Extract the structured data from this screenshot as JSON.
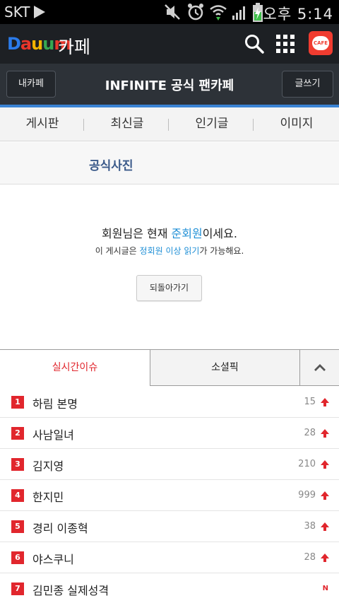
{
  "status_bar": {
    "carrier": "SKT",
    "time": "오후 5:14",
    "icons": [
      "play-icon",
      "mute-icon",
      "alarm-icon",
      "wifi-icon",
      "signal-icon",
      "battery-charging-icon"
    ]
  },
  "app_header": {
    "logo": "Daum",
    "app_name": "카페",
    "icons": [
      "search-icon",
      "apps-grid-icon",
      "cafe-app-icon"
    ],
    "cafe_icon_text": "CAFE"
  },
  "cafe_bar": {
    "my_cafe_label": "내카페",
    "cafe_title": "INFINITE 공식 팬카페",
    "write_label": "글쓰기"
  },
  "menu": {
    "items": [
      {
        "label": "게시판"
      },
      {
        "label": "최신글"
      },
      {
        "label": "인기글"
      },
      {
        "label": "이미지"
      }
    ]
  },
  "board": {
    "title": "공식사진"
  },
  "notice": {
    "main_prefix": "회원님은 현재 ",
    "main_highlight": "준회원",
    "main_suffix": "이세요.",
    "sub_prefix": "이 게시글은 ",
    "sub_highlight": "정회원 이상 읽기",
    "sub_suffix": "가 가능해요.",
    "back_label": "되돌아가기"
  },
  "issue_tabs": {
    "active": "실시간이슈",
    "realtime_label": "실시간이슈",
    "social_label": "소셜픽"
  },
  "issues": [
    {
      "rank": "1",
      "keyword": "하림 본명",
      "count": "15",
      "trend": "up"
    },
    {
      "rank": "2",
      "keyword": "사남일녀",
      "count": "28",
      "trend": "up"
    },
    {
      "rank": "3",
      "keyword": "김지영",
      "count": "210",
      "trend": "up"
    },
    {
      "rank": "4",
      "keyword": "한지민",
      "count": "999",
      "trend": "up"
    },
    {
      "rank": "5",
      "keyword": "경리 이종혁",
      "count": "38",
      "trend": "up"
    },
    {
      "rank": "6",
      "keyword": "야스쿠니",
      "count": "28",
      "trend": "up"
    },
    {
      "rank": "7",
      "keyword": "김민종 실제성격",
      "count": "",
      "trend": "new",
      "badge": "N"
    }
  ],
  "colors": {
    "accent_red": "#e1262d",
    "highlight_blue": "#1f8fd6",
    "stripe_blue": "#3a83d4",
    "app_bar": "#1d2024",
    "cafe_bar": "#2d3238"
  }
}
